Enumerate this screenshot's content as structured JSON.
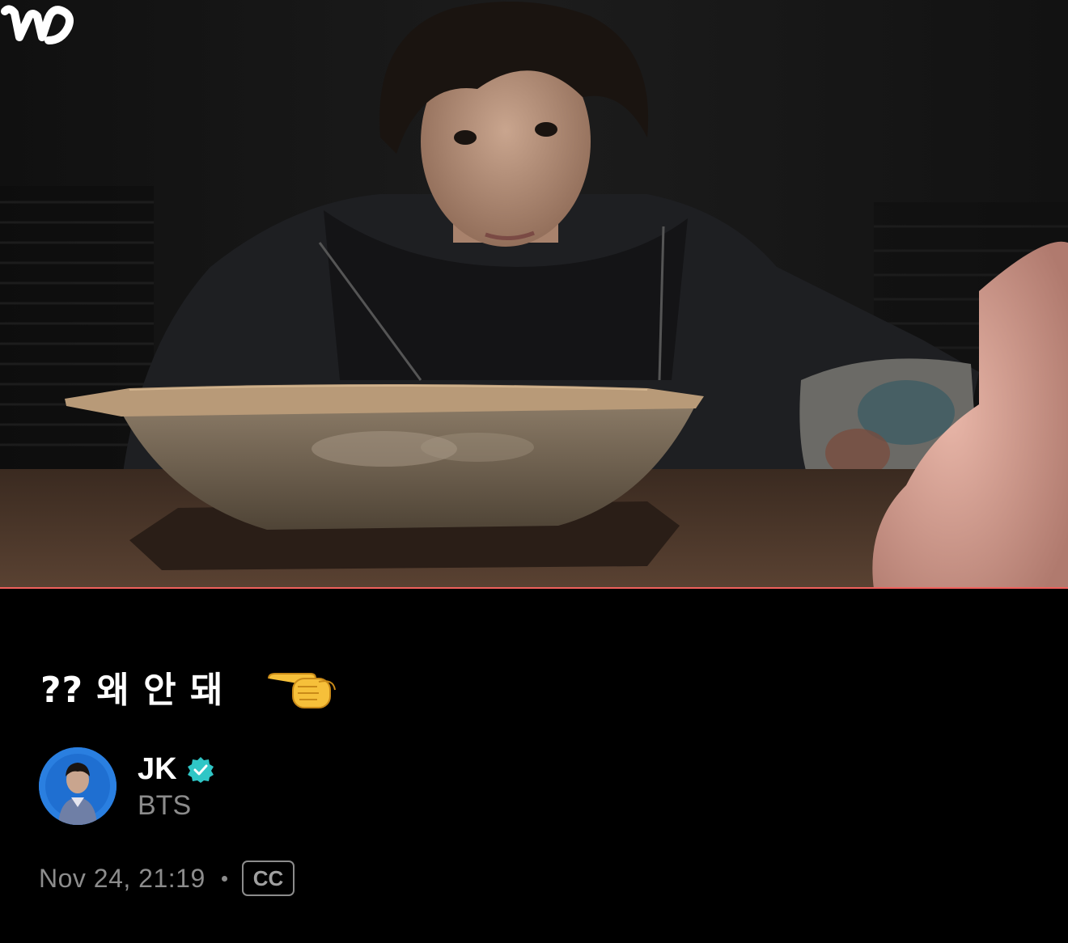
{
  "video": {
    "progress_percent": 100,
    "progress_color": "#f0605c",
    "brand_icon": "weverse-w-icon"
  },
  "post": {
    "caption": "?? 왜 안 돼",
    "caption_emoji": "backhand-index-pointing-right-emoji"
  },
  "author": {
    "name": "JK",
    "group": "BTS",
    "verified_icon": "verified-badge-icon",
    "verified_color": "#2fc6c6"
  },
  "meta": {
    "timestamp": "Nov 24, 21:19",
    "cc_label": "CC"
  }
}
